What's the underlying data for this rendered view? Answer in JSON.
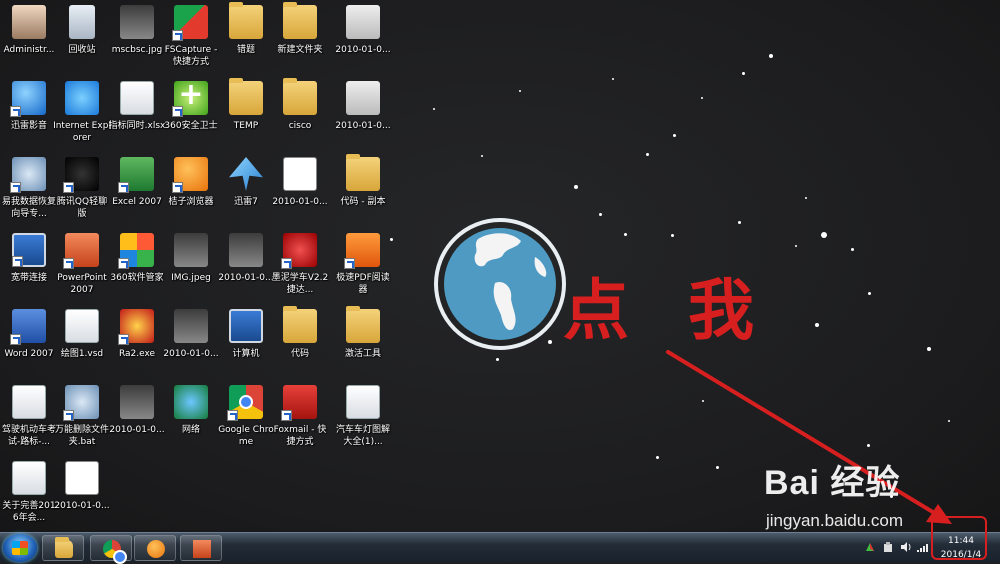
{
  "desktop": {
    "icons": [
      {
        "label": "Administr...",
        "kind": "person"
      },
      {
        "label": "回收站",
        "kind": "bin"
      },
      {
        "label": "mscbsc.jpg",
        "kind": "img"
      },
      {
        "label": "FSCapture - 快捷方式",
        "kind": "capture"
      },
      {
        "label": "错题",
        "kind": "folder"
      },
      {
        "label": "新建文件夹",
        "kind": "folder"
      },
      {
        "label": "2010-01-0...",
        "kind": "small"
      },
      {
        "label": "迅雷影音",
        "kind": "blue"
      },
      {
        "label": "Internet Explorer",
        "kind": "ie"
      },
      {
        "label": "指标同时.xlsx",
        "kind": "doc"
      },
      {
        "label": "360安全卫士",
        "kind": "plus"
      },
      {
        "label": "TEMP",
        "kind": "folder"
      },
      {
        "label": "cisco",
        "kind": "folder"
      },
      {
        "label": "2010-01-0...",
        "kind": "small"
      },
      {
        "label": "易我数据恢复向导专...",
        "kind": "gear"
      },
      {
        "label": "腾讯QQ轻聊版",
        "kind": "qq"
      },
      {
        "label": "Excel 2007",
        "kind": "excel"
      },
      {
        "label": "桔子浏览器",
        "kind": "orange"
      },
      {
        "label": "迅雷7",
        "kind": "bird"
      },
      {
        "label": "2010-01-0...",
        "kind": "thumb"
      },
      {
        "label": "代码 - 副本",
        "kind": "folder"
      },
      {
        "label": "宽带连接",
        "kind": "pc"
      },
      {
        "label": "PowerPoint 2007",
        "kind": "ppt"
      },
      {
        "label": "360软件管家",
        "kind": "apps"
      },
      {
        "label": "IMG.jpeg",
        "kind": "img"
      },
      {
        "label": "2010-01-0...",
        "kind": "img"
      },
      {
        "label": "墨泥学车V2.2捷达...",
        "kind": "car"
      },
      {
        "label": "极速PDF阅读器",
        "kind": "pdf"
      },
      {
        "label": "Word 2007",
        "kind": "word"
      },
      {
        "label": "绘图1.vsd",
        "kind": "doc"
      },
      {
        "label": "Ra2.exe",
        "kind": "hat"
      },
      {
        "label": "2010-01-0...",
        "kind": "img"
      },
      {
        "label": "计算机",
        "kind": "pc"
      },
      {
        "label": "代码",
        "kind": "folder"
      },
      {
        "label": "激活工具",
        "kind": "folder"
      },
      {
        "label": "驾驶机动车考试-路标-...",
        "kind": "doc"
      },
      {
        "label": "万能删除文件夹.bat",
        "kind": "gear"
      },
      {
        "label": "2010-01-0...",
        "kind": "img"
      },
      {
        "label": "网络",
        "kind": "net"
      },
      {
        "label": "Google Chrome",
        "kind": "chrome"
      },
      {
        "label": "Foxmail - 快捷方式",
        "kind": "red"
      },
      {
        "label": "汽车车灯图解大全(1)...",
        "kind": "doc"
      },
      {
        "label": "关于完善2016年会...",
        "kind": "doc"
      },
      {
        "label": "2010-01-0...",
        "kind": "thumb"
      }
    ],
    "annotation": {
      "text": "点 我",
      "color": "#d81f1f"
    },
    "watermark": {
      "brand": "Bai 经验",
      "url": "jingyan.baidu.com"
    }
  },
  "taskbar": {
    "start_icon": "windows-logo-icon",
    "pinned": [
      "explorer-icon",
      "chrome-icon",
      "orange-browser-icon",
      "powerpoint-icon"
    ],
    "tray_icons": [
      "flag-icon",
      "action-center-icon",
      "volume-icon",
      "network-signal-icon"
    ],
    "clock": {
      "time": "11:44",
      "date": "2016/1/4"
    }
  }
}
